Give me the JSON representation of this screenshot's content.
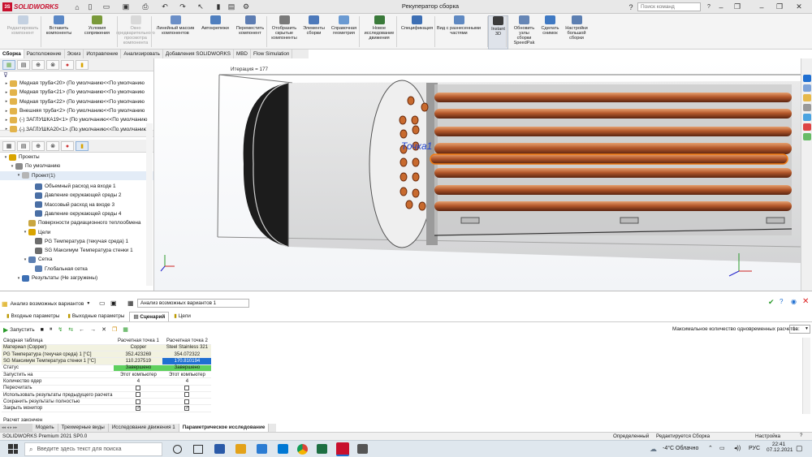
{
  "app": {
    "name": "SOLIDWORKS",
    "document_title": "Рекуператор сборка",
    "search_placeholder": "Поиск команд"
  },
  "ribbon": {
    "buttons": [
      {
        "label": "Редактировать\nкомпонент",
        "disabled": true
      },
      {
        "label": "Вставить\nкомпоненты",
        "disabled": false
      },
      {
        "label": "Условия\nсопряжения",
        "disabled": false
      },
      {
        "label": "Окно\nпредварительного\nпросмотра\nкомпонента",
        "disabled": true
      },
      {
        "label": "Линейный массив\nкомпонентов",
        "disabled": false
      },
      {
        "label": "Автокрепежи",
        "disabled": false
      },
      {
        "label": "Переместить\nкомпонент",
        "disabled": false
      },
      {
        "label": "Отобразить\nскрытые\nкомпоненты",
        "disabled": false
      },
      {
        "label": "Элементы\nсборки",
        "disabled": false
      },
      {
        "label": "Справочная\nгеометрия",
        "disabled": false
      },
      {
        "label": "Новое\nисследование\nдвижения",
        "disabled": false
      },
      {
        "label": "Спецификация",
        "disabled": false
      },
      {
        "label": "Вид с разнесенными\nчастями",
        "disabled": false
      },
      {
        "label": "Instant\n3D",
        "disabled": false
      },
      {
        "label": "Обновить\nузлы\nсборки\nSpeedPak",
        "disabled": false
      },
      {
        "label": "Сделать\nснимок",
        "disabled": false
      },
      {
        "label": "Настройки\nбольшой\nсборки",
        "disabled": false
      }
    ]
  },
  "command_tabs": [
    "Сборка",
    "Расположение",
    "Эскиз",
    "Исправление",
    "Анализировать",
    "Добавления SOLIDWORKS",
    "MBD",
    "Flow Simulation"
  ],
  "feature_tree": [
    "Медная труба<20> (По умолчанию<<По умолчанию",
    "Медная труба<21> (По умолчанию<<По умолчанию",
    "Медная труба<22> (По умолчанию<<По умолчанию",
    "Внешняя труба<2> (По умолчанию<<По умолчанию",
    "(-) ЗАГЛУШКА19<1> (По умолчанию<<По умолчанию",
    "(-) ЗАГЛУШКА20<1> (По умолчанию<<По умолчанию"
  ],
  "flow_tree": [
    {
      "label": "Проекты",
      "indent": 0
    },
    {
      "label": "По умолчанию",
      "indent": 1
    },
    {
      "label": "Проект(1)",
      "indent": 2
    },
    {
      "label": "Объемный расход на входе 1",
      "indent": 4
    },
    {
      "label": "Давление окружающей среды 2",
      "indent": 4
    },
    {
      "label": "Массовый расход на входе 3",
      "indent": 4
    },
    {
      "label": "Давление окружающей среды 4",
      "indent": 4
    },
    {
      "label": "Поверхности радиационного теплообмена",
      "indent": 3
    },
    {
      "label": "Цели",
      "indent": 3
    },
    {
      "label": "PG Температура (текучая среда) 1",
      "indent": 4
    },
    {
      "label": "SG Максимум Температура стенки 1",
      "indent": 4
    },
    {
      "label": "Сетка",
      "indent": 3
    },
    {
      "label": "Глобальная сетка",
      "indent": 4
    },
    {
      "label": "Результаты (Не загружены)",
      "indent": 2
    }
  ],
  "viewport": {
    "iteration_label": "Итерация = 177",
    "point_label": "Точка1"
  },
  "bottom_panel": {
    "analysis_dropdown": "Анализ возможных вариантов",
    "study_name": "Анализ возможных вариантов 1",
    "tabs": [
      "Входные параметры",
      "Выходные параметры",
      "Сценарий",
      "Цели"
    ],
    "active_tab": "Сценарий",
    "run_label": "Запустить",
    "max_calc_label": "Максимальное количество одновременных расчетов:",
    "max_calc_value": "1",
    "table": {
      "columns": [
        "Сводная таблица",
        "Расчетная точка 1",
        "Расчетная точка 2"
      ],
      "rows": [
        [
          "Материал (Copper)",
          "Copper",
          "Steel Stainless 321"
        ],
        [
          "PG Температура (текучая среда) 1 [°C]",
          "352.423269",
          "354.072322"
        ],
        [
          "SG Максимум Температура стенки 1 [°C]",
          "110.237519",
          "170.810194"
        ],
        [
          "Статус",
          "Завершено",
          "Завершено"
        ],
        [
          "Запустить на",
          "Этот компьютер",
          "Этот компьютер"
        ],
        [
          "Количество ядер",
          "4",
          "4"
        ],
        [
          "Пересчитать",
          "",
          ""
        ],
        [
          "Использовать результаты предыдущего расчета",
          "",
          ""
        ],
        [
          "Сохранить результаты полностью",
          "",
          ""
        ],
        [
          "Закрыть монитор",
          "",
          ""
        ]
      ],
      "checkboxes": {
        "Пересчитать": [
          false,
          false
        ],
        "Использовать результаты предыдущего расчета": [
          false,
          false
        ],
        "Сохранить результаты полностью": [
          false,
          false
        ],
        "Закрыть монитор": [
          true,
          true
        ]
      }
    },
    "footer_status": "Расчет закончен"
  },
  "bottom_tabs": [
    "Модель",
    "Трехмерные виды",
    "Исследование движения 1",
    "Параметрическое исследование"
  ],
  "active_bottom_tab": "Параметрическое исследование",
  "status_bar": {
    "left": "SOLIDWORKS Premium 2021 SP0.0",
    "state": "Определенный",
    "edit_mode": "Редактируется Сборка",
    "settings": "Настройка"
  },
  "taskbar": {
    "search_placeholder": "Введите здесь текст для поиска",
    "weather": "-4°C Облачно",
    "lang": "РУС",
    "time": "22:41",
    "date": "07.12.2021"
  },
  "colors": {
    "accent": "#c8102e",
    "selected_blue": "#1f6fd1",
    "status_green": "#5ed05e",
    "copper": "#b05a2a"
  }
}
